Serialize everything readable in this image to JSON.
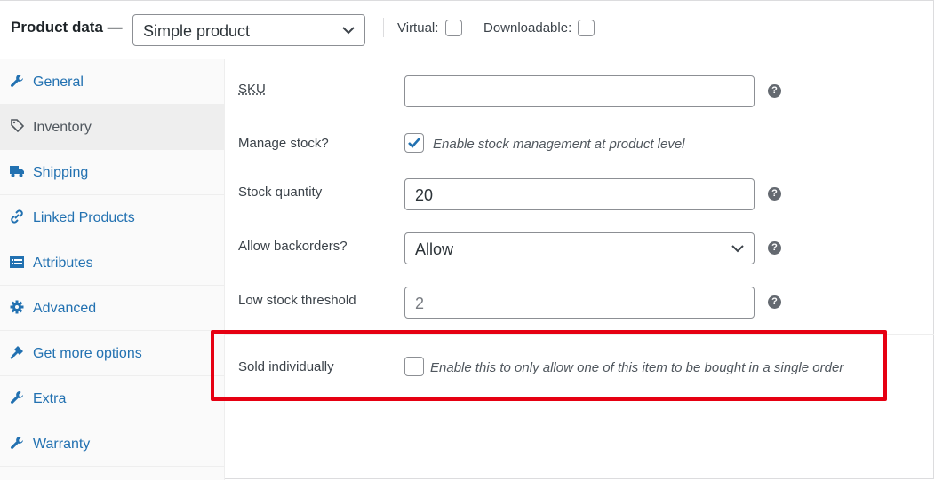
{
  "header": {
    "title": "Product data",
    "title_dash": "—",
    "product_type": "Simple product",
    "virtual_label": "Virtual:",
    "downloadable_label": "Downloadable:"
  },
  "sidebar": {
    "tabs": [
      {
        "label": "General",
        "icon": "wrench-icon"
      },
      {
        "label": "Inventory",
        "icon": "tag-icon"
      },
      {
        "label": "Shipping",
        "icon": "truck-icon"
      },
      {
        "label": "Linked Products",
        "icon": "link-icon"
      },
      {
        "label": "Attributes",
        "icon": "list-icon"
      },
      {
        "label": "Advanced",
        "icon": "gear-icon"
      },
      {
        "label": "Get more options",
        "icon": "plugin-icon"
      },
      {
        "label": "Extra",
        "icon": "wrench-icon"
      },
      {
        "label": "Warranty",
        "icon": "wrench-icon"
      }
    ],
    "active_tab": "Inventory"
  },
  "inventory": {
    "sku_label": "SKU",
    "sku_value": "",
    "manage_stock_label": "Manage stock?",
    "manage_stock_desc": "Enable stock management at product level",
    "manage_stock_checked": true,
    "stock_qty_label": "Stock quantity",
    "stock_qty_value": "20",
    "backorders_label": "Allow backorders?",
    "backorders_value": "Allow",
    "low_stock_label": "Low stock threshold",
    "low_stock_placeholder": "2",
    "sold_individually_label": "Sold individually",
    "sold_individually_desc": "Enable this to only allow one of this item to be bought in a single order",
    "sold_individually_checked": false,
    "help_glyph": "?"
  },
  "colors": {
    "link": "#2271b1",
    "highlight": "#e60012"
  }
}
